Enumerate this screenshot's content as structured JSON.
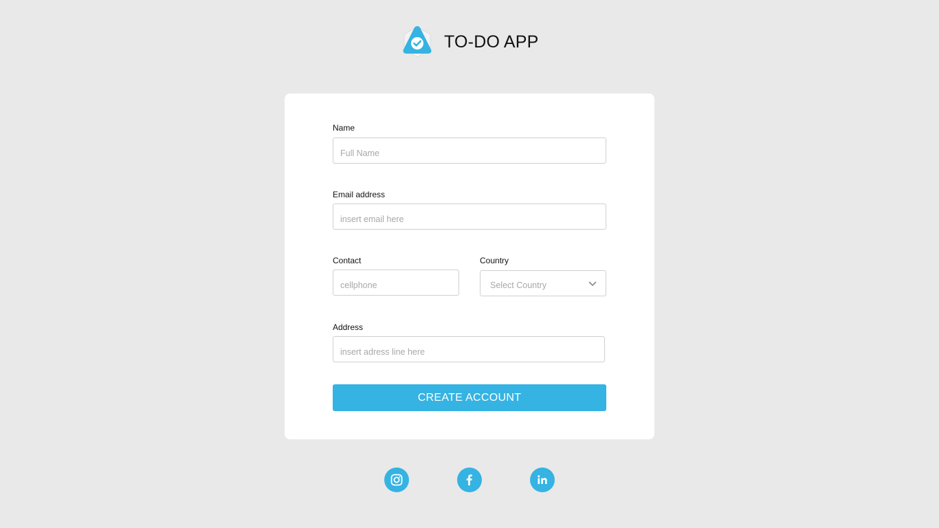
{
  "app": {
    "title": "TO-DO APP",
    "logo_icon": "checkmark-badge-icon",
    "accent_color": "#35b3e3",
    "background_color": "#e9e9e9"
  },
  "form": {
    "name": {
      "label": "Name",
      "placeholder": "Full Name",
      "value": ""
    },
    "email": {
      "label": "Email address",
      "placeholder": "insert email here",
      "value": ""
    },
    "contact": {
      "label": "Contact",
      "placeholder": "cellphone",
      "value": ""
    },
    "country": {
      "label": "Country",
      "selected": "Select Country",
      "icon": "chevron-down-icon"
    },
    "address": {
      "label": "Address",
      "placeholder": "insert adress line here",
      "value": ""
    },
    "submit_label": "CREATE ACCOUNT"
  },
  "social": [
    {
      "name": "instagram",
      "icon": "instagram-icon"
    },
    {
      "name": "facebook",
      "icon": "facebook-icon"
    },
    {
      "name": "linkedin",
      "icon": "linkedin-icon"
    }
  ]
}
